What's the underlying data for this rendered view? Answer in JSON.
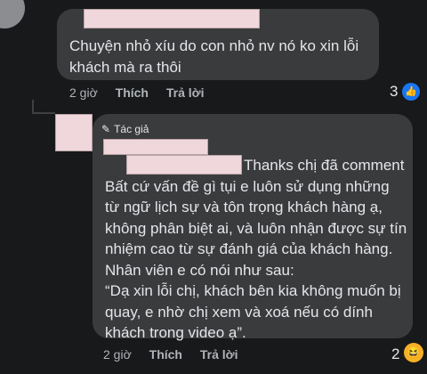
{
  "comment": {
    "text": "Chuyện nhỏ xíu do con nhỏ nv nó ko xin lỗi\nkhách mà ra thôi",
    "time": "2 giờ",
    "like_label": "Thích",
    "reply_label": "Trả lời",
    "reaction_count": "3",
    "reaction_icon": "like-icon"
  },
  "reply": {
    "author_badge": "Tác giả",
    "lines": [
      "Thanks chị đã comment",
      "Bất cứ vấn đề gì tụi e luôn sử dụng những",
      "từ ngữ lịch sự và tôn trọng khách hàng ạ,",
      "không phân biệt ai, và luôn nhận được sự tín",
      "nhiệm cao từ sự đánh giá của khách hàng.",
      "Nhân viên e có nói như sau:",
      "“Dạ xin lỗi chị, khách bên kia không muốn bị",
      "quay, e nhờ chị xem và xoá nếu có dính",
      "khách trong video ạ”."
    ],
    "time": "2 giờ",
    "like_label": "Thích",
    "reply_label": "Trả lời",
    "reaction_count": "2",
    "reaction_icon": "haha-icon"
  }
}
